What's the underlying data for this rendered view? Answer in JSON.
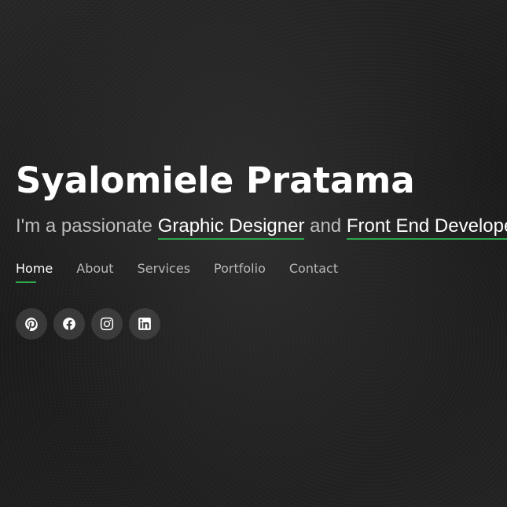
{
  "hero": {
    "name": "Syalomiele Pratama",
    "tagline": {
      "prefix": "I'm a passionate ",
      "role1": "Graphic Designer",
      "connector": " and ",
      "role2": "Front End Developer"
    }
  },
  "nav": {
    "items": [
      {
        "label": "Home",
        "active": true
      },
      {
        "label": "About",
        "active": false
      },
      {
        "label": "Services",
        "active": false
      },
      {
        "label": "Portfolio",
        "active": false
      },
      {
        "label": "Contact",
        "active": false
      }
    ]
  },
  "socials": [
    {
      "icon": "pinterest-icon"
    },
    {
      "icon": "facebook-icon"
    },
    {
      "icon": "instagram-icon"
    },
    {
      "icon": "linkedin-icon"
    }
  ],
  "colors": {
    "accent": "#2ea84a",
    "text": "#ffffff",
    "muted": "#b8b8b8"
  }
}
